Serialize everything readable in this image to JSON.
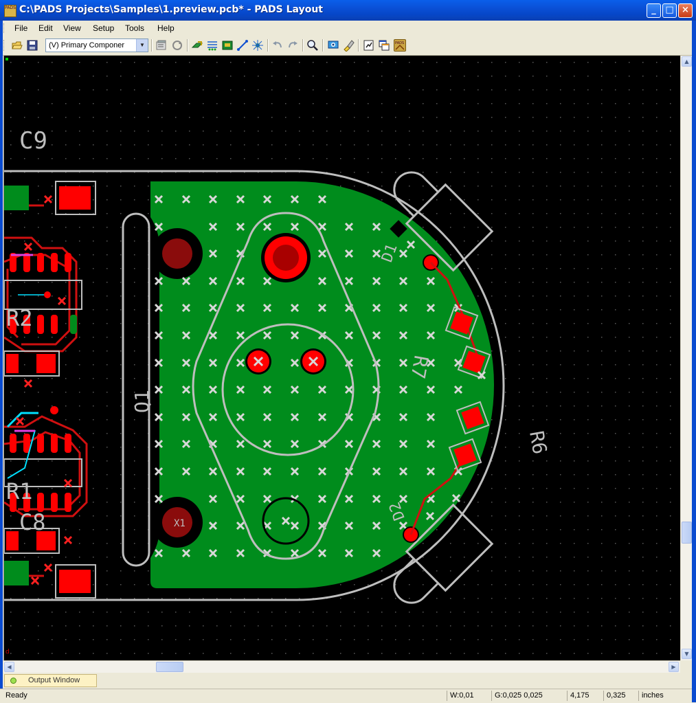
{
  "window": {
    "title": "C:\\PADS Projects\\Samples\\1.preview.pcb* - PADS Layout",
    "icon_label": "PADS",
    "minimize_label": "_",
    "maximize_label": "□",
    "close_label": "×"
  },
  "menu": {
    "items": [
      "File",
      "Edit",
      "View",
      "Setup",
      "Tools",
      "Help"
    ]
  },
  "toolbar": {
    "layer_select_value": "(V) Primary Componer",
    "icons": [
      "open-icon",
      "save-icon",
      "properties-icon",
      "refresh-icon",
      "route-icon",
      "autoroute-icon",
      "board-icon",
      "trace-icon",
      "cluster-icon",
      "undo-icon",
      "redo-icon",
      "zoom-icon",
      "view-icon",
      "highlight-icon",
      "report-icon",
      "windows-icon",
      "pads-logo-icon"
    ]
  },
  "pcb": {
    "ref_labels": {
      "c9": "C9",
      "r2": "R2",
      "r1": "R1",
      "c8": "C8",
      "q1": "Q1",
      "x1": "X1",
      "d1": "D1",
      "d2": "D2",
      "r7": "R7",
      "r6": "R6"
    },
    "colors": {
      "background": "#000000",
      "copper_pour": "#008C1C",
      "pad": "#FF0000",
      "silkscreen": "#BEBEBE",
      "trace": "#D01010",
      "via": "#C8C8C8",
      "jumper_cyan": "#00E0FF",
      "jumper_magenta": "#E040E0"
    }
  },
  "output_window": {
    "tab_label": "Output Window"
  },
  "statusbar": {
    "status": "Ready",
    "width": "W:0,01",
    "grid": "G:0,025 0,025",
    "x": "4,175",
    "y": "0,325",
    "units": "inches"
  }
}
